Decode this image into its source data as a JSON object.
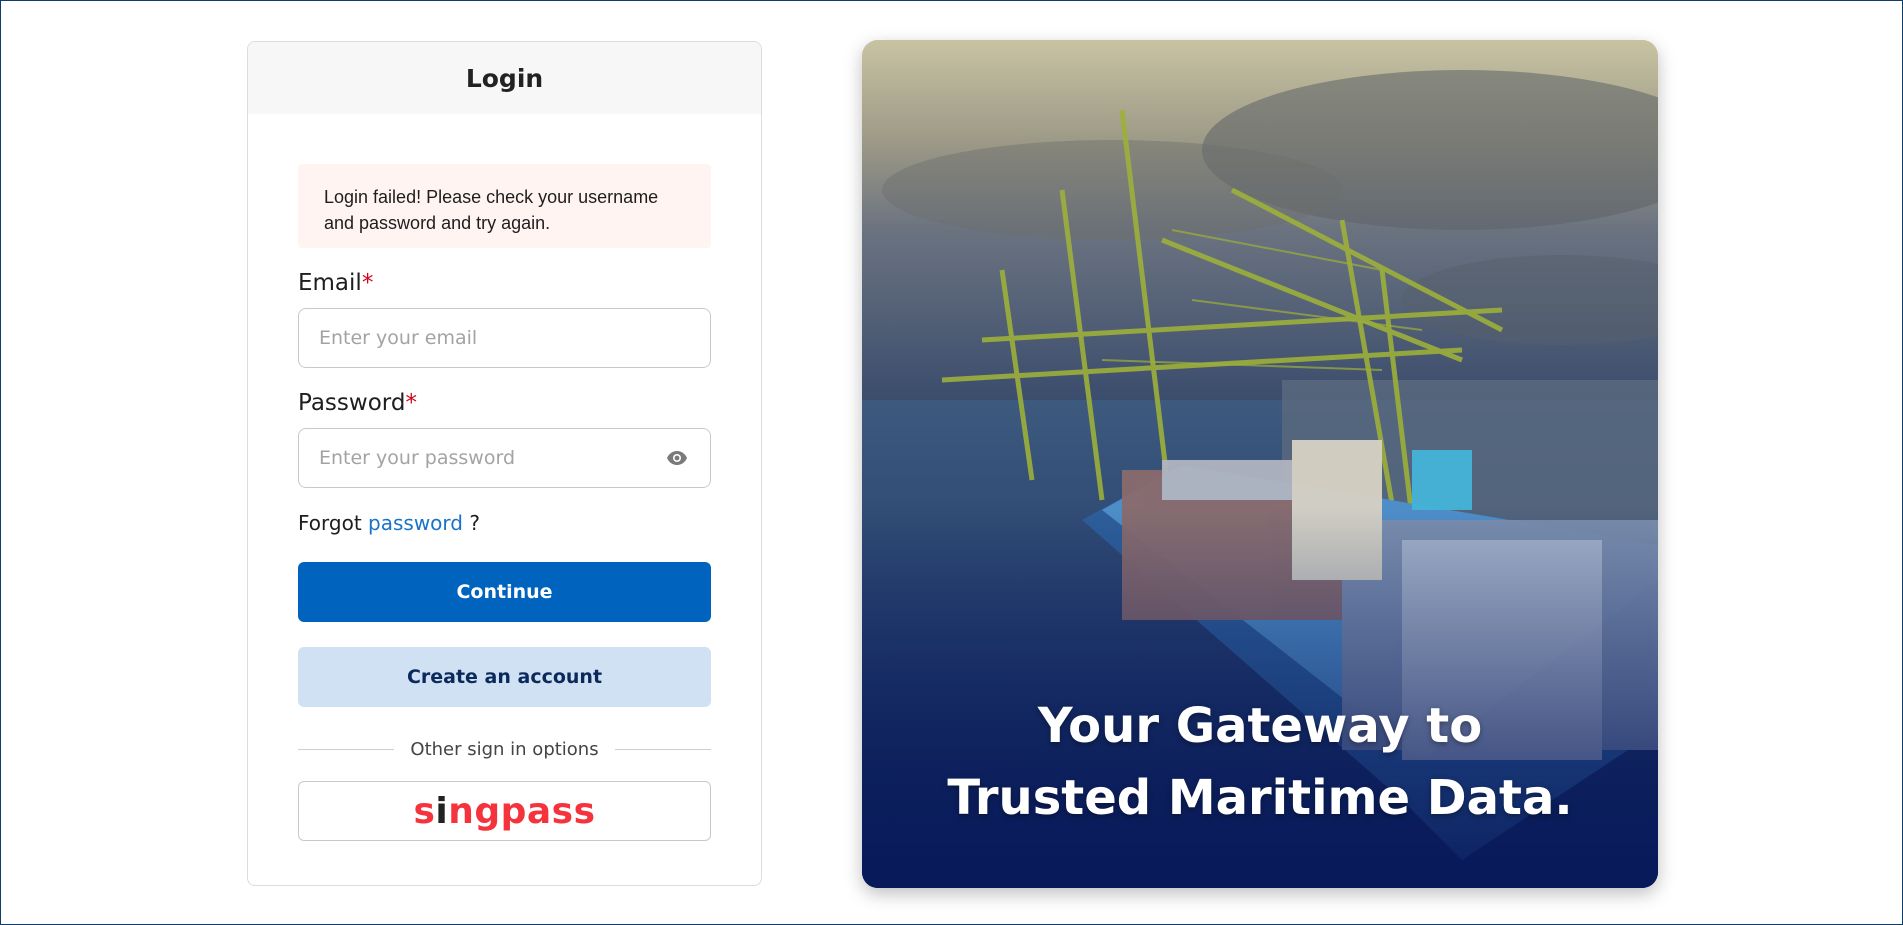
{
  "login": {
    "title": "Login",
    "alert": "Login failed! Please check your username and password and try again.",
    "email_label": "Email",
    "email_placeholder": "Enter your email",
    "password_label": "Password",
    "password_placeholder": "Enter your password",
    "required_mark": "*",
    "forgot_prefix": "Forgot",
    "forgot_link": "password",
    "forgot_suffix": "?",
    "continue_label": "Continue",
    "create_account_label": "Create an account",
    "other_options_label": "Other sign in options",
    "singpass_logo": "singpass"
  },
  "hero": {
    "line1": "Your Gateway to",
    "line2": "Trusted Maritime Data."
  },
  "icons": {
    "password_toggle": "eye-icon"
  },
  "colors": {
    "primary": "#0063be",
    "secondary": "#cfe1f3",
    "error_bg": "#fff4f2",
    "required": "#d6001c",
    "link": "#1a73c8",
    "singpass": "#f4333d"
  }
}
